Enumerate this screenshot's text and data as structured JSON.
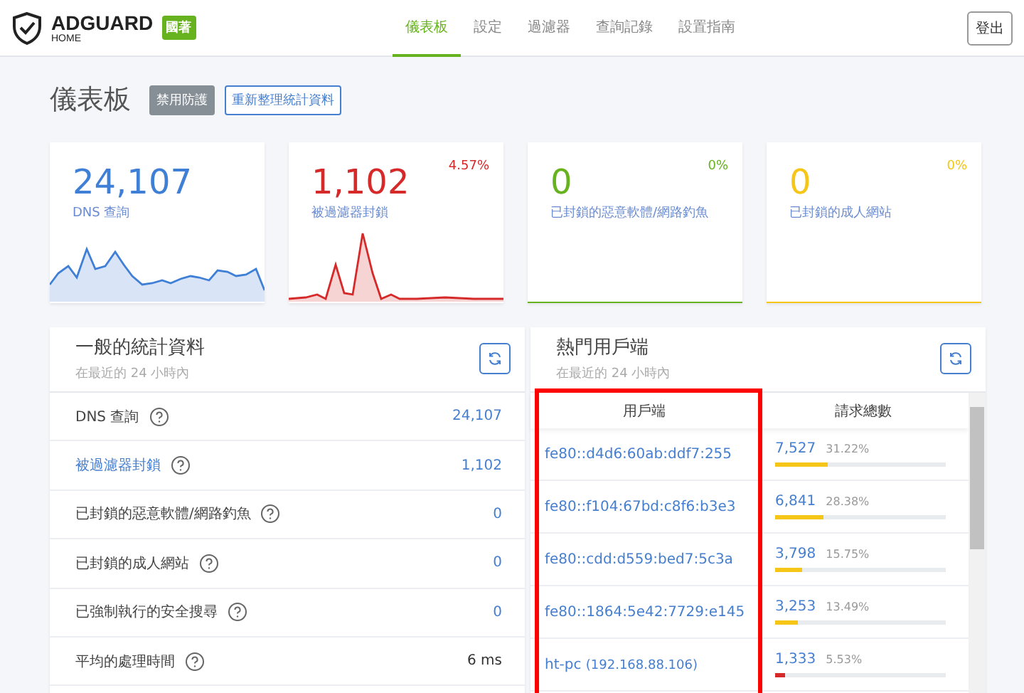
{
  "header": {
    "logo_title": "ADGUARD",
    "logo_subtitle": "HOME",
    "badge": "國著",
    "nav": [
      {
        "label": "儀表板",
        "selected": true
      },
      {
        "label": "設定",
        "selected": false
      },
      {
        "label": "過濾器",
        "selected": false
      },
      {
        "label": "查詢記錄",
        "selected": false
      },
      {
        "label": "設置指南",
        "selected": false
      }
    ],
    "logout": "登出"
  },
  "page": {
    "title": "儀表板",
    "buttons": [
      {
        "label": "禁用防護",
        "kind": "solid"
      },
      {
        "label": "重新整理統計資料",
        "kind": "outline"
      }
    ]
  },
  "cards": [
    {
      "value": "24,107",
      "label": "DNS 查詢",
      "color": "#3f7fd6",
      "kind": "sparkline"
    },
    {
      "value": "1,102",
      "label": "被過濾器封鎖",
      "percent": "4.57%",
      "color": "#d62a2a",
      "kind": "sparkline"
    },
    {
      "value": "0",
      "label": "已封鎖的惡意軟體/網路釣魚",
      "percent": "0%",
      "color": "#67b21f",
      "kind": "plain"
    },
    {
      "value": "0",
      "label": "已封鎖的成人網站",
      "percent": "0%",
      "color": "#f5c518",
      "kind": "plain"
    }
  ],
  "general_stats": {
    "title": "一般的統計資料",
    "subtitle": "在最近的 24 小時內",
    "rows": [
      {
        "label": "DNS 查詢",
        "value": "24,107",
        "link": false,
        "accent": true
      },
      {
        "label": "被過濾器封鎖",
        "value": "1,102",
        "link": true,
        "accent": true
      },
      {
        "label": "已封鎖的惡意軟體/網路釣魚",
        "value": "0",
        "link": false,
        "accent": true
      },
      {
        "label": "已封鎖的成人網站",
        "value": "0",
        "link": false,
        "accent": true
      },
      {
        "label": "已強制執行的安全搜尋",
        "value": "0",
        "link": false,
        "accent": true
      },
      {
        "label": "平均的處理時間",
        "value": "6 ms",
        "link": false,
        "accent": false
      }
    ]
  },
  "top_clients": {
    "title": "熱門用戶端",
    "subtitle": "在最近的 24 小時內",
    "columns": [
      {
        "label": "用戶端",
        "highlighted": true
      },
      {
        "label": "請求總數",
        "highlighted": false
      }
    ],
    "rows": [
      {
        "client": "fe80::d4d6:60ab:ddf7:255",
        "count": "7,527",
        "percent": "31.22%",
        "level": 0.3122,
        "color": "#f5c518"
      },
      {
        "client": "fe80::f104:67bd:c8f6:b3e3",
        "count": "6,841",
        "percent": "28.38%",
        "level": 0.2838,
        "color": "#f5c518"
      },
      {
        "client": "fe80::cdd:d559:bed7:5c3a",
        "count": "3,798",
        "percent": "15.75%",
        "level": 0.1575,
        "color": "#f5c518"
      },
      {
        "client": "fe80::1864:5e42:7729:e145",
        "count": "3,253",
        "percent": "13.49%",
        "level": 0.1349,
        "color": "#f5c518"
      },
      {
        "client": "ht-pc",
        "client_ip": "(192.168.88.106)",
        "count": "1,333",
        "percent": "5.53%",
        "level": 0.0553,
        "color": "#d62a2a"
      }
    ]
  }
}
